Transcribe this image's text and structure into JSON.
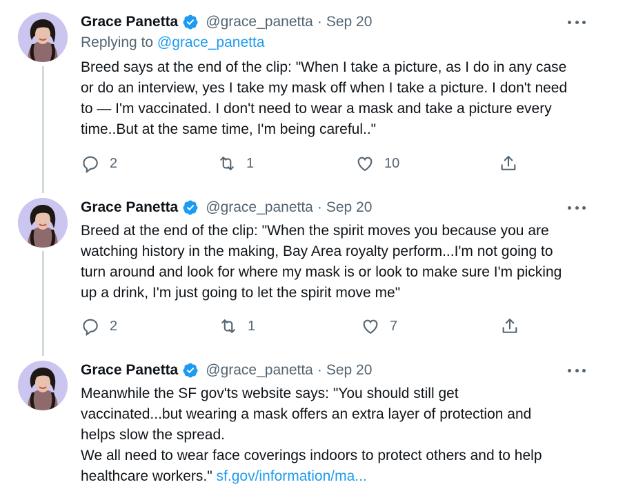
{
  "tweets": [
    {
      "author": "Grace Panetta",
      "handle": "@grace_panetta",
      "separator": "·",
      "date": "Sep 20",
      "replying_label": "Replying to",
      "replying_to": "@grace_panetta",
      "text": "Breed says at the end of the clip: \"When I take a picture, as I do in any case\nor do an interview, yes I take my mask off when I take a picture. I don't need\nto — I'm vaccinated. I don't need to wear a mask and take a picture every\ntime..But at the same time, I'm being careful..\"",
      "replies": "2",
      "retweets": "1",
      "likes": "10"
    },
    {
      "author": "Grace Panetta",
      "handle": "@grace_panetta",
      "separator": "·",
      "date": "Sep 20",
      "text": "Breed at the end of the clip: \"When the spirit moves you because you are\nwatching history in the making, Bay Area royalty perform...I'm not going to\nturn around and look for where my mask is or look to make sure I'm picking\nup a drink, I'm just going to let the spirit move me\"",
      "replies": "2",
      "retweets": "1",
      "likes": "7"
    },
    {
      "author": "Grace Panetta",
      "handle": "@grace_panetta",
      "separator": "·",
      "date": "Sep 20",
      "text": "Meanwhile the SF gov'ts website says: \"You should still get\nvaccinated...but wearing a mask offers an extra layer of protection and\nhelps slow the spread.\nWe all need to wear face coverings indoors to protect others and to help\nhealthcare workers.\" ",
      "link": "sf.gov/information/ma..."
    }
  ],
  "colors": {
    "accent": "#1d9bf0",
    "secondary_text": "#536471",
    "thread_line": "#cfd9de",
    "avatar_bg": "#cbc6ef"
  },
  "icons": [
    "verified-badge-icon",
    "more-icon",
    "reply-icon",
    "retweet-icon",
    "like-icon",
    "share-icon"
  ]
}
